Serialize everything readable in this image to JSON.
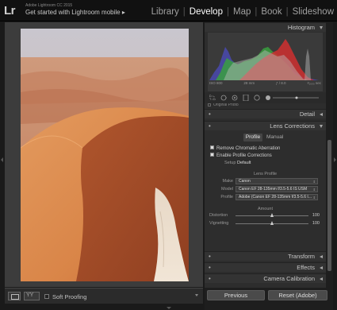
{
  "app": {
    "logo": "Lr",
    "title": "Adobe Lightroom CC 2015",
    "subtitle": "Get started with Lightroom mobile ▸"
  },
  "modules": [
    "Library",
    "Develop",
    "Map",
    "Book",
    "Slideshow"
  ],
  "active_module": "Develop",
  "histogram": {
    "title": "Histogram",
    "iso": "ISO 800",
    "focal": "28 mm",
    "aperture": "ƒ / 8.0",
    "shutter": "¹⁄₁₀₀₀ sec",
    "original_photo_label": "Original Photo"
  },
  "sections": {
    "detail": "Detail",
    "lens": "Lens Corrections",
    "transform": "Transform",
    "effects": "Effects",
    "calibration": "Camera Calibration"
  },
  "lens": {
    "tabs": [
      "Profile",
      "Manual"
    ],
    "remove_ca": "Remove Chromatic Aberration",
    "enable_profile": "Enable Profile Corrections",
    "setup_label": "Setup",
    "setup_value": "Default",
    "lens_profile_title": "Lens Profile",
    "make_label": "Make",
    "make_value": "Canon",
    "model_label": "Model",
    "model_value": "Canon EF 28-135mm f/3.5-5.6 IS USM",
    "profile_label": "Profile",
    "profile_value": "Adobe (Canon EF 28-135mm f/3.5-5.6 I...",
    "amount_title": "Amount",
    "distortion_label": "Distortion",
    "distortion_value": "100",
    "vignetting_label": "Vignetting",
    "vignetting_value": "100"
  },
  "toolbar": {
    "soft_proofing": "Soft Proofing"
  },
  "footer": {
    "previous": "Previous",
    "reset": "Reset (Adobe)"
  }
}
